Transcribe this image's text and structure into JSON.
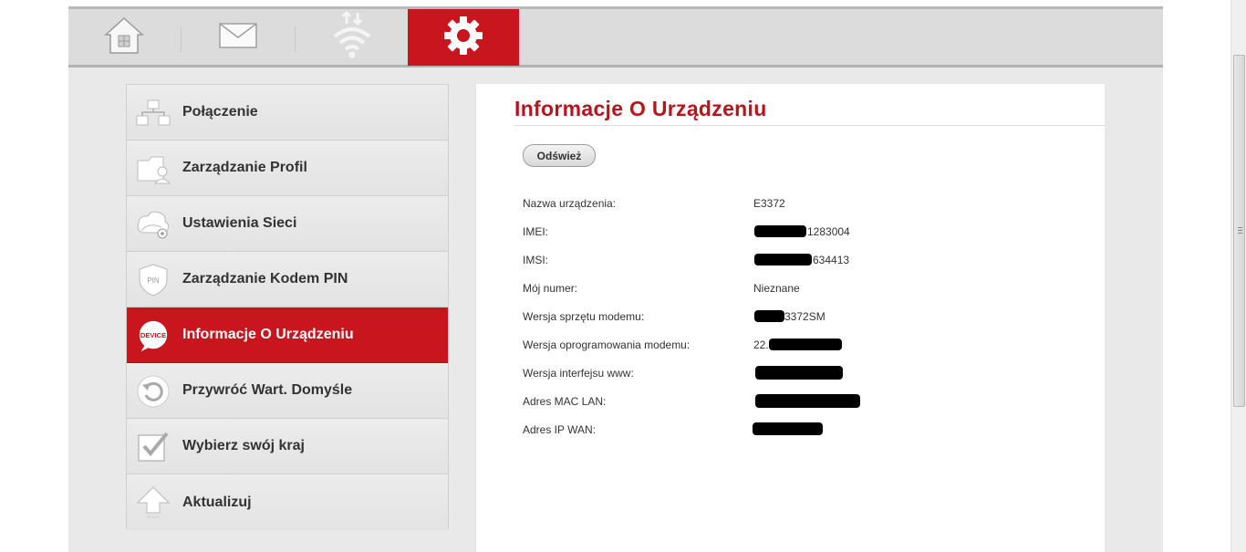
{
  "topnav": {
    "items": [
      {
        "icon": "home-icon",
        "active": false
      },
      {
        "icon": "mail-icon",
        "active": false
      },
      {
        "icon": "wifi-icon",
        "active": false
      },
      {
        "icon": "gear-icon",
        "active": true
      }
    ]
  },
  "sidebar": {
    "items": [
      {
        "label": "Połączenie",
        "icon": "network-icon",
        "active": false
      },
      {
        "label": "Zarządzanie Profil",
        "icon": "profile-icon",
        "active": false
      },
      {
        "label": "Ustawienia Sieci",
        "icon": "network-settings-icon",
        "active": false
      },
      {
        "label": "Zarządzanie Kodem PIN",
        "icon": "pin-shield-icon",
        "active": false
      },
      {
        "label": "Informacje O Urządzeniu",
        "icon": "device-icon",
        "active": true
      },
      {
        "label": "Przywróć Wart. Domyśle",
        "icon": "restore-icon",
        "active": false
      },
      {
        "label": "Wybierz swój kraj",
        "icon": "checkbox-icon",
        "active": false
      },
      {
        "label": "Aktualizuj",
        "icon": "upload-arrow-icon",
        "active": false
      }
    ],
    "pin_badge": "PIN",
    "device_badge": "DEVICE"
  },
  "main": {
    "title": "Informacje O Urządzeniu",
    "refresh_label": "Odśwież",
    "info": [
      {
        "label": "Nazwa urządzenia:",
        "value": "E3372"
      },
      {
        "label": "IMEI:",
        "value": "1283004"
      },
      {
        "label": "IMSI:",
        "value": "634413"
      },
      {
        "label": "Mój numer:",
        "value": "Nieznane"
      },
      {
        "label": "Wersja sprzętu modemu:",
        "value": "3372SM"
      },
      {
        "label": "Wersja oprogramowania modemu:",
        "value": "22."
      },
      {
        "label": "Wersja interfejsu www:",
        "value": ""
      },
      {
        "label": "Adres MAC LAN:",
        "value": ""
      },
      {
        "label": "Adres IP WAN:",
        "value": ""
      }
    ]
  },
  "colors": {
    "accent": "#c8151e",
    "title": "#b8141d"
  }
}
